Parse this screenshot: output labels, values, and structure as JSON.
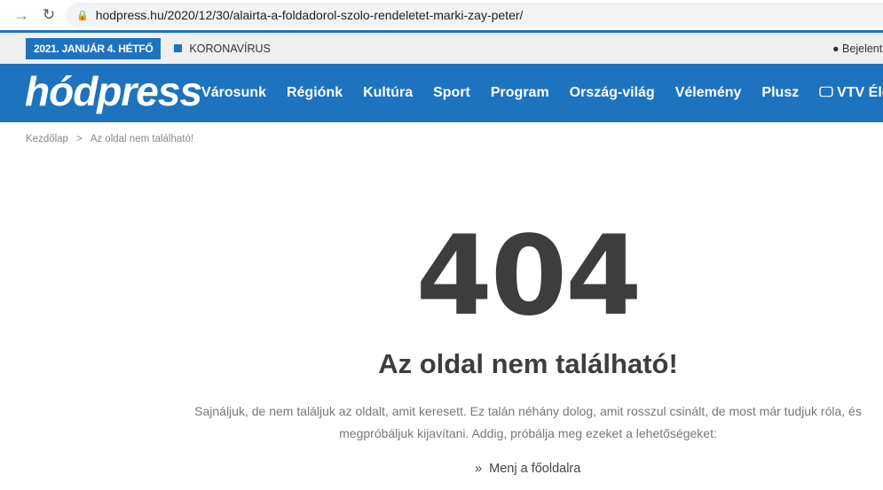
{
  "browser": {
    "url": "hodpress.hu/2020/12/30/alairta-a-foldadorol-szolo-rendeletet-marki-zay-peter/"
  },
  "topbar": {
    "date": "2021. JANUÁR 4. HÉTFŐ",
    "tag": "KORONAVÍRUS",
    "login": "Bejelentkezés"
  },
  "brand": {
    "logo": "hódpress",
    "color": "#1e73be"
  },
  "menu": [
    "Városunk",
    "Régiónk",
    "Kultúra",
    "Sport",
    "Program",
    "Ország-világ",
    "Vélemény",
    "Plusz",
    "VTV Élő"
  ],
  "breadcrumb": {
    "home": "Kezdőlap",
    "current": "Az oldal nem található!"
  },
  "error": {
    "code": "404",
    "title": "Az oldal nem található!",
    "message": "Sajnáljuk, de nem találjuk az oldalt, amit keresett. Ez talán néhány dolog, amit rosszul csinált, de most már tudjuk róla, és megpróbáljuk kijavítani. Addig, próbálja meg ezeket a lehetőségeket:",
    "home_link": "Menj a főoldalra"
  }
}
